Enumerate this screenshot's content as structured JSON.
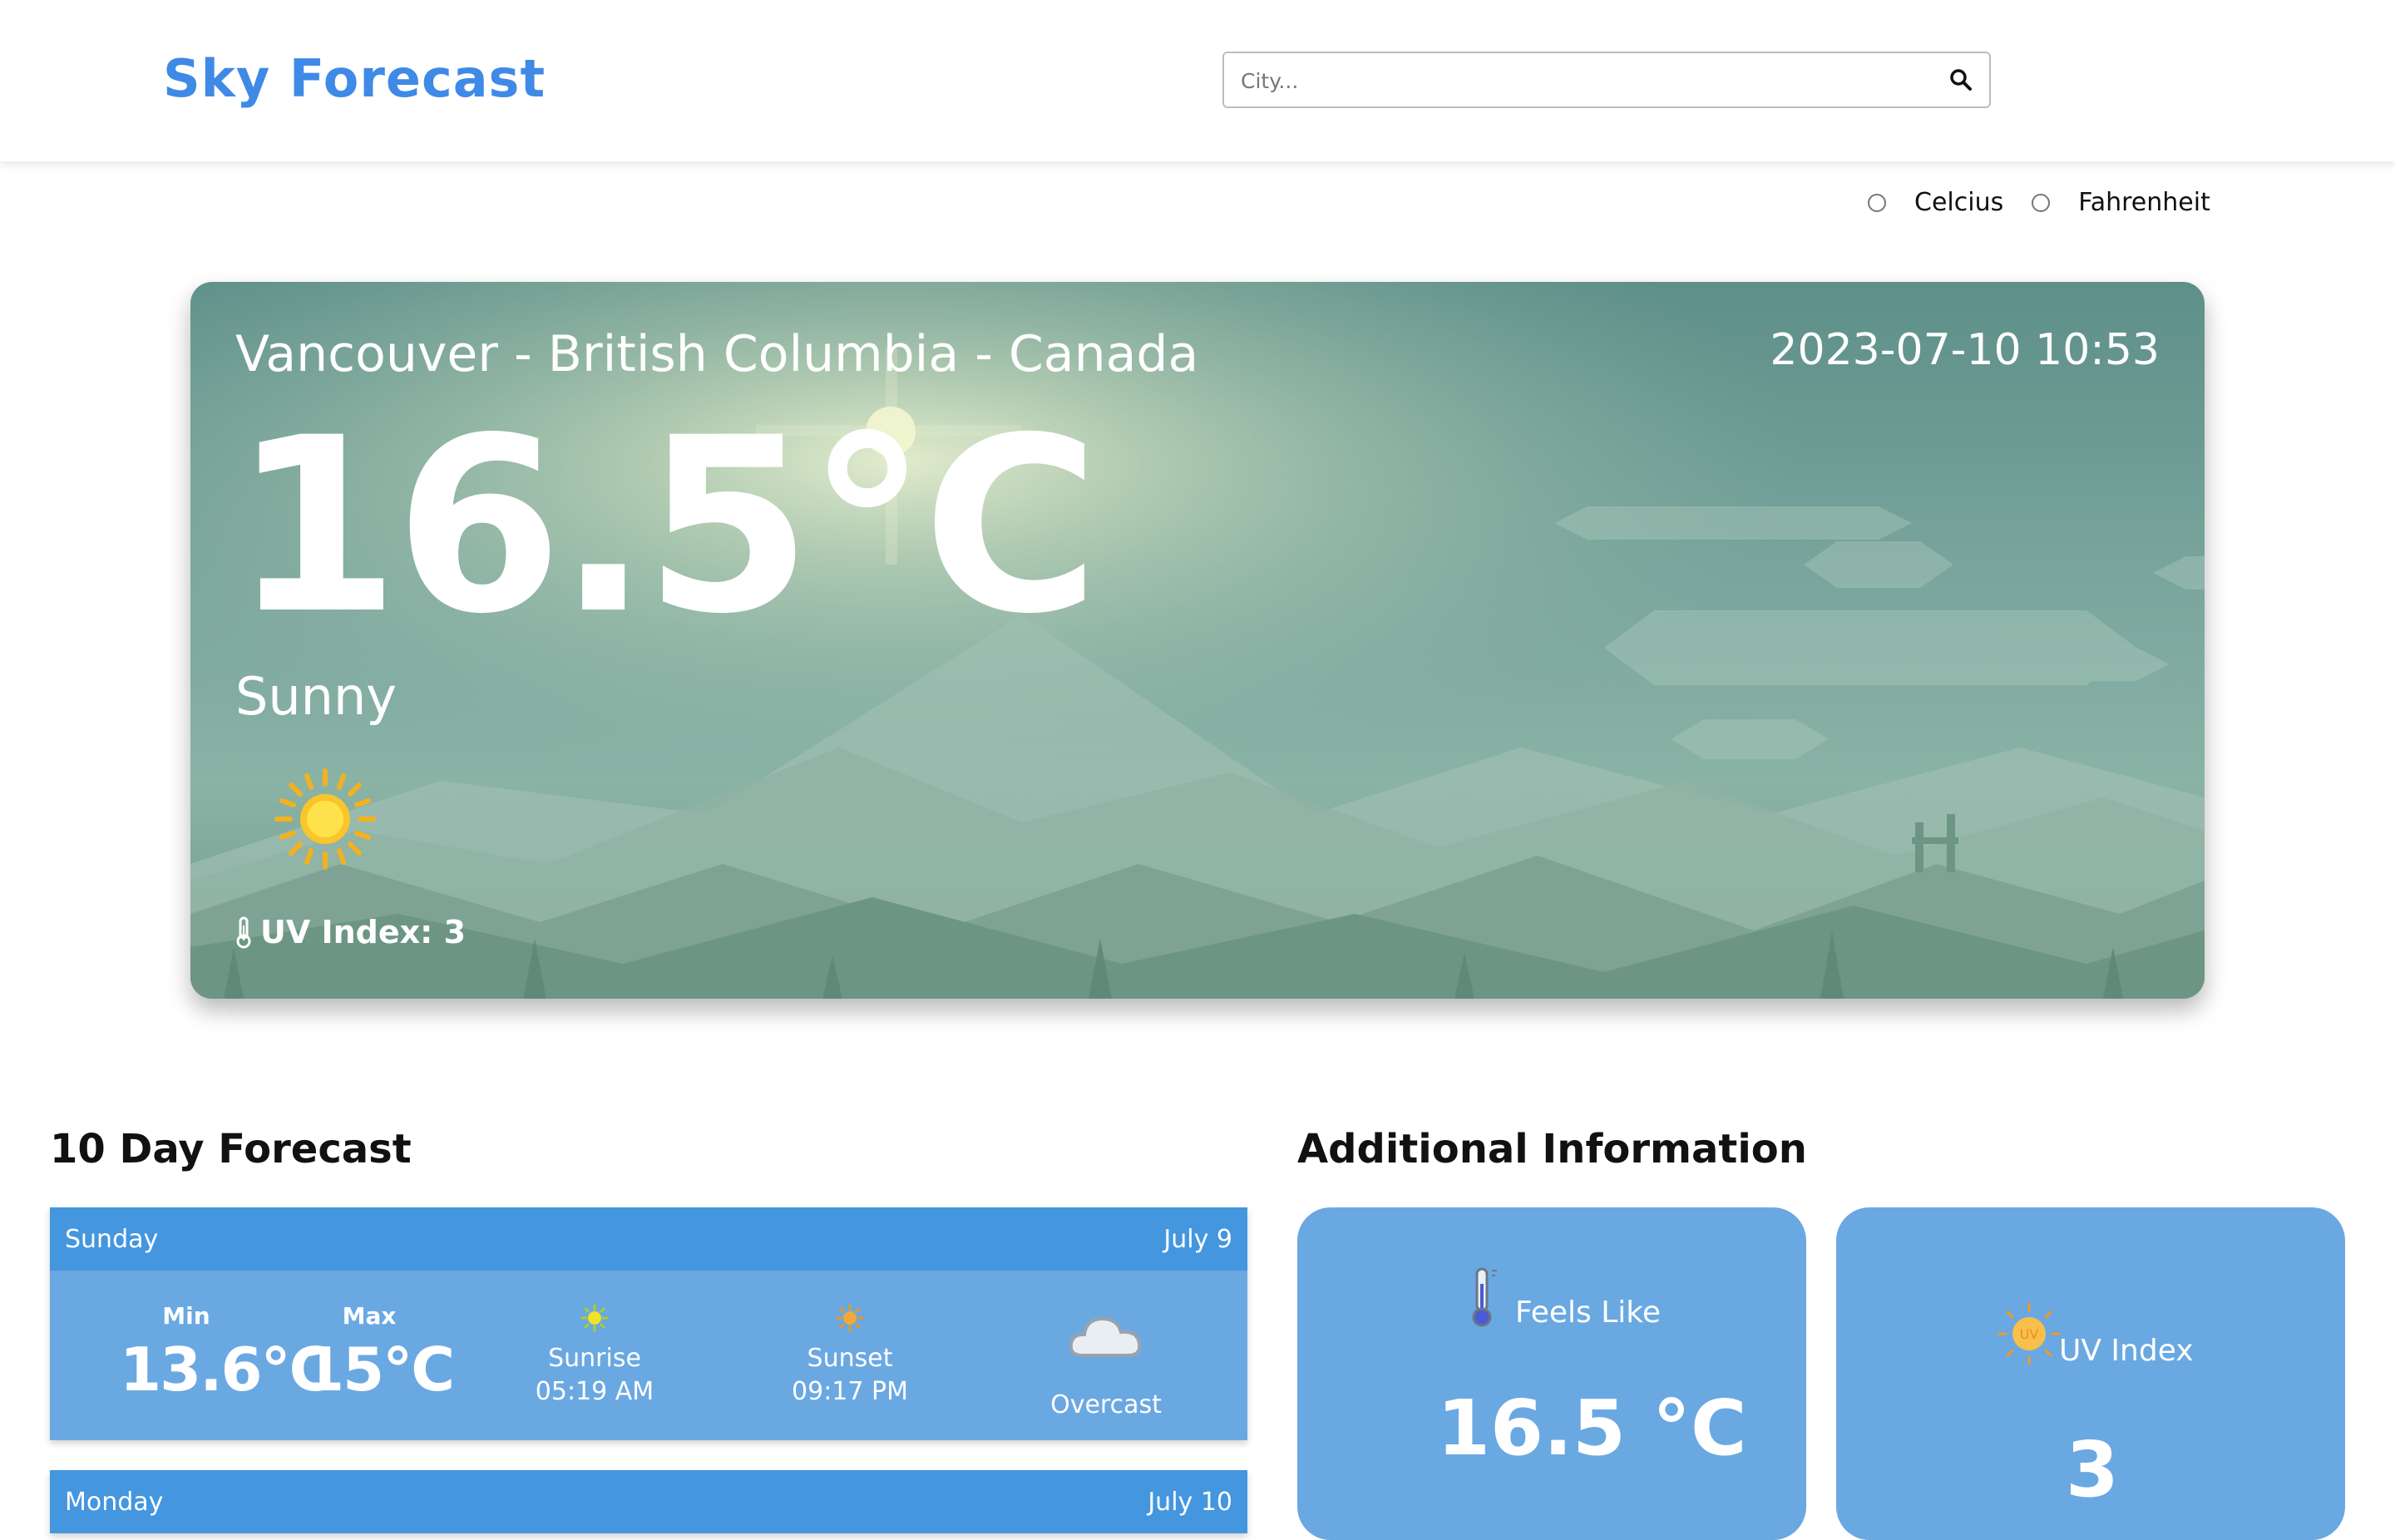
{
  "header": {
    "brand": "Sky Forecast",
    "search_placeholder": "City...",
    "search_icon": "search-icon"
  },
  "units": {
    "celsius_label": "Celcius",
    "fahrenheit_label": "Fahrenheit",
    "selected": null
  },
  "current": {
    "location": "Vancouver - British Columbia - Canada",
    "datetime": "2023-07-10 10:53",
    "temperature": "16.5°C",
    "condition": "Sunny",
    "condition_icon": "sun-icon",
    "uv_label": "UV Index: 3"
  },
  "forecast": {
    "heading": "10 Day Forecast",
    "days": [
      {
        "day": "Sunday",
        "date": "July 9",
        "min_label": "Min",
        "min": "13.6°C",
        "max_label": "Max",
        "max": "15°C",
        "sunrise_label": "Sunrise",
        "sunrise": "05:19 AM",
        "sunset_label": "Sunset",
        "sunset": "09:17 PM",
        "condition": "Overcast",
        "condition_icon": "cloud-icon"
      },
      {
        "day": "Monday",
        "date": "July 10"
      }
    ]
  },
  "additional": {
    "heading": "Additional Information",
    "cards": [
      {
        "title": "Feels Like",
        "value": "16.5 °C",
        "icon": "thermometer-icon"
      },
      {
        "title": "UV Index",
        "value": "3",
        "icon": "uv-sun-icon"
      }
    ]
  },
  "colors": {
    "brand": "#3f8ae6",
    "forecast_header": "#4496df",
    "forecast_body": "#6aa8e2",
    "card": "#6aa8e2"
  }
}
